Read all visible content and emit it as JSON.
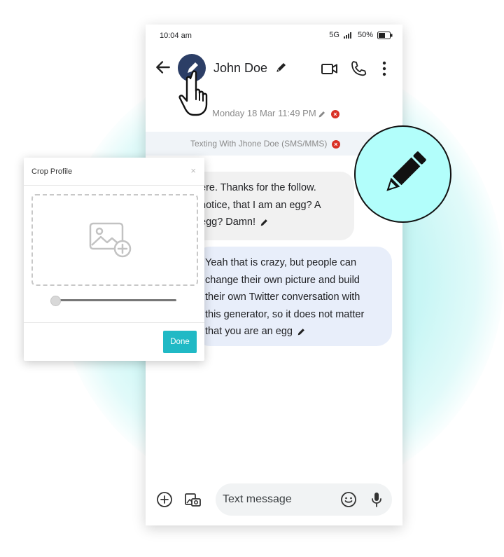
{
  "status": {
    "time": "10:04 am",
    "network": "5G",
    "battery": "50%"
  },
  "header": {
    "contact_name": "John Doe"
  },
  "conversation": {
    "date": "Monday 18 Mar 11:49 PM",
    "texting_with": "Texting With Jhone Doe (SMS/MMS)",
    "messages": [
      {
        "lines": [
          "ere. Thanks for the follow.",
          "notice, that I am an egg? A",
          "egg? Damn!"
        ]
      },
      {
        "lines": [
          "Yeah that is crazy, but people can",
          "change their own picture and build",
          "their own Twitter conversation with",
          "this generator, so it does not matter",
          "that you are an egg"
        ]
      }
    ]
  },
  "composer": {
    "placeholder": "Text message"
  },
  "crop_dialog": {
    "title": "Crop Profile",
    "close": "×",
    "zoom_level": 0.0,
    "done_label": "Done"
  },
  "colors": {
    "accent": "#20b9c5",
    "avatar": "#2c3e66",
    "badge_bg": "#b2fefb",
    "received_bubble": "#f1f1f1",
    "sent_bubble": "#e8eefa",
    "delete_red": "#d93025"
  },
  "icons": [
    "back-arrow-icon",
    "avatar-pencil-icon",
    "pencil-icon",
    "video-call-icon",
    "phone-icon",
    "more-vert-icon",
    "pointing-hand-icon",
    "delete-x-icon",
    "add-circle-icon",
    "gallery-icon",
    "emoji-icon",
    "mic-icon",
    "add-image-icon",
    "big-pencil-icon"
  ]
}
